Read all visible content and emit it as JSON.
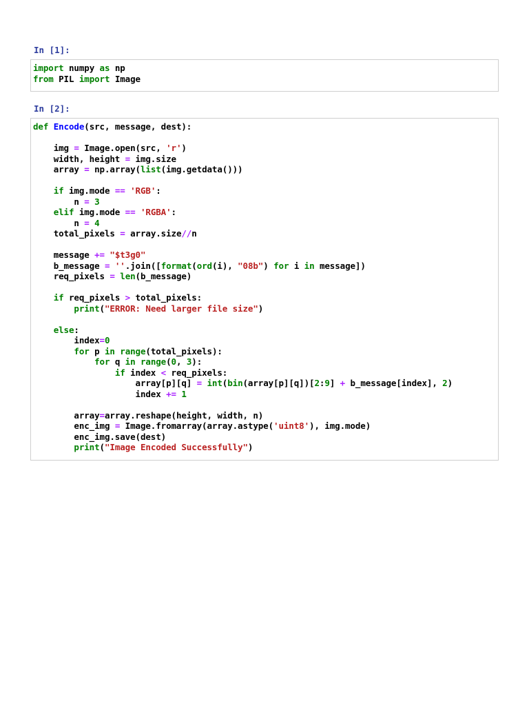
{
  "cells": [
    {
      "prompt": "In [1]:",
      "lines": [
        [
          [
            "import",
            "k"
          ],
          [
            " numpy ",
            ""
          ],
          [
            "as",
            "k"
          ],
          [
            " np",
            ""
          ]
        ],
        [
          [
            "from",
            "k"
          ],
          [
            " PIL ",
            ""
          ],
          [
            "import",
            "k"
          ],
          [
            " Image",
            ""
          ]
        ]
      ]
    },
    {
      "prompt": "In [2]:",
      "lines": [
        [
          [
            "def",
            "k"
          ],
          [
            " ",
            ""
          ],
          [
            "Encode",
            "f"
          ],
          [
            "(src, message, dest):",
            ""
          ]
        ],
        [],
        [
          [
            "    img ",
            ""
          ],
          [
            "=",
            "o"
          ],
          [
            " Image.open(src, ",
            ""
          ],
          [
            "'r'",
            "s"
          ],
          [
            ")",
            ""
          ]
        ],
        [
          [
            "    width, height ",
            ""
          ],
          [
            "=",
            "o"
          ],
          [
            " img.size",
            ""
          ]
        ],
        [
          [
            "    array ",
            ""
          ],
          [
            "=",
            "o"
          ],
          [
            " np.array(",
            ""
          ],
          [
            "list",
            "b"
          ],
          [
            "(img.getdata()))",
            ""
          ]
        ],
        [],
        [
          [
            "    ",
            ""
          ],
          [
            "if",
            "k"
          ],
          [
            " img.mode ",
            ""
          ],
          [
            "==",
            "o"
          ],
          [
            " ",
            ""
          ],
          [
            "'RGB'",
            "s"
          ],
          [
            ":",
            ""
          ]
        ],
        [
          [
            "        n ",
            ""
          ],
          [
            "=",
            "o"
          ],
          [
            " ",
            ""
          ],
          [
            "3",
            "n"
          ]
        ],
        [
          [
            "    ",
            ""
          ],
          [
            "elif",
            "k"
          ],
          [
            " img.mode ",
            ""
          ],
          [
            "==",
            "o"
          ],
          [
            " ",
            ""
          ],
          [
            "'RGBA'",
            "s"
          ],
          [
            ":",
            ""
          ]
        ],
        [
          [
            "        n ",
            ""
          ],
          [
            "=",
            "o"
          ],
          [
            " ",
            ""
          ],
          [
            "4",
            "n"
          ]
        ],
        [
          [
            "    total_pixels ",
            ""
          ],
          [
            "=",
            "o"
          ],
          [
            " array.size",
            ""
          ],
          [
            "//",
            "o"
          ],
          [
            "n",
            ""
          ]
        ],
        [],
        [
          [
            "    message ",
            ""
          ],
          [
            "+=",
            "o"
          ],
          [
            " ",
            ""
          ],
          [
            "\"$t3g0\"",
            "s"
          ]
        ],
        [
          [
            "    b_message ",
            ""
          ],
          [
            "=",
            "o"
          ],
          [
            " ",
            ""
          ],
          [
            "''",
            "s"
          ],
          [
            ".join([",
            ""
          ],
          [
            "format",
            "b"
          ],
          [
            "(",
            ""
          ],
          [
            "ord",
            "b"
          ],
          [
            "(i), ",
            ""
          ],
          [
            "\"08b\"",
            "s"
          ],
          [
            ") ",
            ""
          ],
          [
            "for",
            "k"
          ],
          [
            " i ",
            ""
          ],
          [
            "in",
            "k"
          ],
          [
            " message])",
            ""
          ]
        ],
        [
          [
            "    req_pixels ",
            ""
          ],
          [
            "=",
            "o"
          ],
          [
            " ",
            ""
          ],
          [
            "len",
            "b"
          ],
          [
            "(b_message)",
            ""
          ]
        ],
        [],
        [
          [
            "    ",
            ""
          ],
          [
            "if",
            "k"
          ],
          [
            " req_pixels ",
            ""
          ],
          [
            ">",
            "o"
          ],
          [
            " total_pixels:",
            ""
          ]
        ],
        [
          [
            "        ",
            ""
          ],
          [
            "print",
            "b"
          ],
          [
            "(",
            ""
          ],
          [
            "\"ERROR: Need larger file size\"",
            "s"
          ],
          [
            ")",
            ""
          ]
        ],
        [],
        [
          [
            "    ",
            ""
          ],
          [
            "else",
            "k"
          ],
          [
            ":",
            ""
          ]
        ],
        [
          [
            "        index",
            ""
          ],
          [
            "=",
            "o"
          ],
          [
            "0",
            "n"
          ]
        ],
        [
          [
            "        ",
            ""
          ],
          [
            "for",
            "k"
          ],
          [
            " p ",
            ""
          ],
          [
            "in",
            "k"
          ],
          [
            " ",
            ""
          ],
          [
            "range",
            "b"
          ],
          [
            "(total_pixels):",
            ""
          ]
        ],
        [
          [
            "            ",
            ""
          ],
          [
            "for",
            "k"
          ],
          [
            " q ",
            ""
          ],
          [
            "in",
            "k"
          ],
          [
            " ",
            ""
          ],
          [
            "range",
            "b"
          ],
          [
            "(",
            ""
          ],
          [
            "0",
            "n"
          ],
          [
            ", ",
            ""
          ],
          [
            "3",
            "n"
          ],
          [
            "):",
            ""
          ]
        ],
        [
          [
            "                ",
            ""
          ],
          [
            "if",
            "k"
          ],
          [
            " index ",
            ""
          ],
          [
            "<",
            "o"
          ],
          [
            " req_pixels:",
            ""
          ]
        ],
        [
          [
            "                    array[p][q] ",
            ""
          ],
          [
            "=",
            "o"
          ],
          [
            " ",
            ""
          ],
          [
            "int",
            "b"
          ],
          [
            "(",
            ""
          ],
          [
            "bin",
            "b"
          ],
          [
            "(array[p][q])[",
            ""
          ],
          [
            "2",
            "n"
          ],
          [
            ":",
            ""
          ],
          [
            "9",
            "n"
          ],
          [
            "] ",
            ""
          ],
          [
            "+",
            "o"
          ],
          [
            " b_message[index], ",
            ""
          ],
          [
            "2",
            "n"
          ],
          [
            ")",
            ""
          ]
        ],
        [
          [
            "                    index ",
            ""
          ],
          [
            "+=",
            "o"
          ],
          [
            " ",
            ""
          ],
          [
            "1",
            "n"
          ]
        ],
        [],
        [
          [
            "        array",
            ""
          ],
          [
            "=",
            "o"
          ],
          [
            "array.reshape(height, width, n)",
            ""
          ]
        ],
        [
          [
            "        enc_img ",
            ""
          ],
          [
            "=",
            "o"
          ],
          [
            " Image.fromarray(array.astype(",
            ""
          ],
          [
            "'uint8'",
            "s"
          ],
          [
            "), img.mode)",
            ""
          ]
        ],
        [
          [
            "        enc_img.save(dest)",
            ""
          ]
        ],
        [
          [
            "        ",
            ""
          ],
          [
            "print",
            "b"
          ],
          [
            "(",
            ""
          ],
          [
            "\"Image Encoded Successfully\"",
            "s"
          ],
          [
            ")",
            ""
          ]
        ]
      ]
    }
  ]
}
